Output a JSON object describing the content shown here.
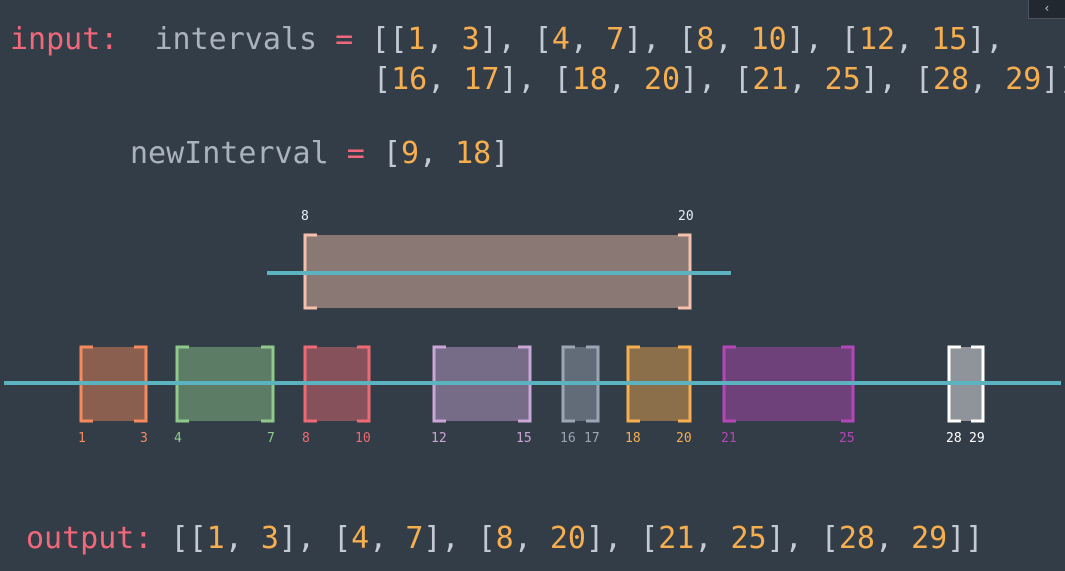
{
  "input": {
    "keyword": "input:",
    "intervals_name": "intervals",
    "eq": "=",
    "intervals_line1": [
      [
        "1",
        "3"
      ],
      [
        "4",
        "7"
      ],
      [
        "8",
        "10"
      ],
      [
        "12",
        "15"
      ]
    ],
    "intervals_line2": [
      [
        "16",
        "17"
      ],
      [
        "18",
        "20"
      ],
      [
        "21",
        "25"
      ],
      [
        "28",
        "29"
      ]
    ]
  },
  "new_interval": {
    "name": "newInterval",
    "eq": "=",
    "values": [
      "9",
      "18"
    ]
  },
  "output": {
    "keyword": "output:",
    "values": [
      [
        "1",
        "3"
      ],
      [
        "4",
        "7"
      ],
      [
        "8",
        "20"
      ],
      [
        "21",
        "25"
      ],
      [
        "28",
        "29"
      ]
    ]
  },
  "diagram": {
    "merged": {
      "start": 8,
      "end": 20,
      "start_label": "8",
      "end_label": "20",
      "color": "#f4c0ac"
    },
    "intervals": [
      {
        "start": 1,
        "end": 3,
        "color": "#f58a5c"
      },
      {
        "start": 4,
        "end": 7,
        "color": "#8fca8a"
      },
      {
        "start": 8,
        "end": 10,
        "color": "#ee6a73"
      },
      {
        "start": 12,
        "end": 15,
        "color": "#c9a6d6"
      },
      {
        "start": 16,
        "end": 17,
        "color": "#9aa6b3"
      },
      {
        "start": 18,
        "end": 20,
        "color": "#f6ae4f"
      },
      {
        "start": 21,
        "end": 25,
        "color": "#b546b7"
      },
      {
        "start": 28,
        "end": 29,
        "color": "#ffffff"
      }
    ],
    "line_color": "#5cb3c0"
  },
  "corner_icon": "chevron-icon"
}
